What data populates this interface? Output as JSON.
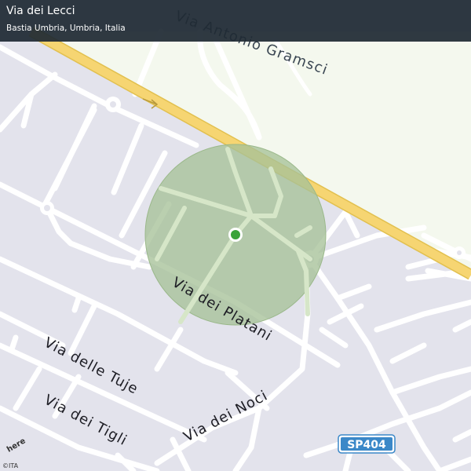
{
  "header": {
    "title": "Via dei Lecci",
    "subtitle": "Bastia Umbria, Umbria, Italia"
  },
  "streets": {
    "gramsci": "Via Antonio Gramsci",
    "platani": "Via dei Platani",
    "tuje": "Via delle Tuje",
    "tigli": "Via dei Tigli",
    "noci": "Via dei Noci"
  },
  "road_shield": "SP404",
  "attribution": "©ITA",
  "logo_text": "here",
  "colors": {
    "land": "#e3e3ec",
    "field": "#f4f8ee",
    "road": "#ffffff",
    "highway": "#f6d572",
    "highway_edge": "#e2c04f",
    "circle_fill": "#a7c298",
    "circle_stroke": "#9ab88a",
    "marker": "#3aa33a",
    "shield": "#3b88c8",
    "header_bg": "#1f2a34"
  }
}
